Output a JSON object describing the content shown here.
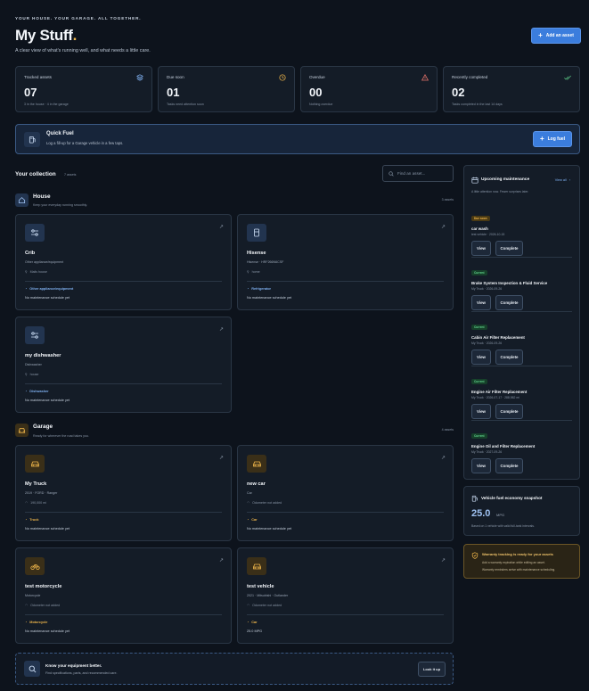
{
  "header": {
    "eyebrow": "YOUR HOUSE. YOUR GARAGE. ALL TOGETHER.",
    "title": "My Stuff",
    "title_dot": ".",
    "subtitle": "A clear view of what's running well, and what needs a little care.",
    "add_button": "Add an asset"
  },
  "stats": [
    {
      "label": "Tracked assets",
      "value": "07",
      "sub": "3 in the house · 4 in the garage",
      "icon": "layers-icon",
      "color": "#7fb0f0"
    },
    {
      "label": "Due soon",
      "value": "01",
      "sub": "Tasks need attention soon",
      "icon": "clock-icon",
      "color": "#f2b84b"
    },
    {
      "label": "Overdue",
      "value": "00",
      "sub": "Nothing overdue",
      "icon": "warning-icon",
      "color": "#e5736b"
    },
    {
      "label": "Recently completed",
      "value": "02",
      "sub": "Tasks completed in the last 14 days",
      "icon": "check-icon",
      "color": "#5fcf8a"
    }
  ],
  "quick_fuel": {
    "title": "Quick Fuel",
    "subtitle": "Log a fill-up for a Garage vehicle in a few taps.",
    "button": "Log fuel"
  },
  "collection": {
    "title": "Your collection",
    "count": "7 assets",
    "search_placeholder": "Find an asset..."
  },
  "house": {
    "title": "House",
    "subtitle": "Keep your everyday running smoothly.",
    "count": "3 assets",
    "items": [
      {
        "name": "Crib",
        "desc": "Other appliance/equipment",
        "loc": "Mails house",
        "cat": "Other appliance/equipment",
        "sched": "No maintenance schedule yet",
        "icon": "sliders-icon"
      },
      {
        "name": "Hisense",
        "desc": "Hisense · HRF266N6CSF",
        "loc": "home",
        "cat": "Refrigerator",
        "sched": "No maintenance schedule yet",
        "icon": "fridge-icon"
      },
      {
        "name": "my dishwasher",
        "desc": "Dishwasher",
        "loc": "house",
        "cat": "Dishwasher",
        "sched": "No maintenance schedule yet",
        "icon": "sliders-icon"
      }
    ]
  },
  "garage": {
    "title": "Garage",
    "subtitle": "Ready for wherever the road takes you.",
    "count": "4 assets",
    "items": [
      {
        "name": "My Truck",
        "desc": "2019 · FORD · Ranger",
        "loc": "190,000 mi",
        "cat": "Truck",
        "sched": "No maintenance schedule yet",
        "icon": "car-icon"
      },
      {
        "name": "new car",
        "desc": "Car",
        "loc": "Odometer not added",
        "cat": "Car",
        "sched": "No maintenance schedule yet",
        "icon": "car-icon"
      },
      {
        "name": "test motorcycle",
        "desc": "Motorcycle",
        "loc": "Odometer not added",
        "cat": "Motorcycle",
        "sched": "No maintenance schedule yet",
        "icon": "motorcycle-icon"
      },
      {
        "name": "test vehicle",
        "desc": "2021 · Mitsubishi · Outlander",
        "loc": "Odometer not added",
        "cat": "Car",
        "sched": "25.0 MPG",
        "icon": "car-icon"
      }
    ]
  },
  "know": {
    "title": "Know your equipment better.",
    "subtitle": "Find specifications, parts, and recommended care.",
    "button": "Look it up"
  },
  "maintenance": {
    "title": "Upcoming maintenance",
    "view_all": "View all",
    "subtitle": "A little attention now. Fewer surprises later.",
    "view_label": "View",
    "complete_label": "Complete",
    "items": [
      {
        "badge": "Due soon",
        "title": "car wash",
        "sub": "test vehicle · 2026-10-15"
      },
      {
        "badge": "Current",
        "title": "Brake System Inspection & Fluid Service",
        "sub": "My Truck · 2026-09-26"
      },
      {
        "badge": "Current",
        "title": "Cabin Air Filter Replacement",
        "sub": "My Truck · 2026-09-26"
      },
      {
        "badge": "Current",
        "title": "Engine Air Filter Replacement",
        "sub": "My Truck · 2026-07-17 · 288,982 mi"
      },
      {
        "badge": "Current",
        "title": "Engine Oil and Filter Replacement",
        "sub": "My Truck · 2027-09-26"
      }
    ]
  },
  "fuel": {
    "title": "Vehicle fuel economy snapshot",
    "value": "25.0",
    "unit": "MPG",
    "sub": "Based on 1 vehicle with valid full-tank intervals."
  },
  "warranty": {
    "title": "Warranty tracking is ready for your assets",
    "line1": "Add a warranty expiration while editing an asset.",
    "line2": "Warranty reminders arrive with maintenance scheduling."
  },
  "colors": {
    "accent": "#3b7ddd",
    "due_soon": "#f2b84b",
    "current": "#5fcf8a",
    "house_cat": "#7fb0f0",
    "garage_cat": "#f2b84b"
  }
}
